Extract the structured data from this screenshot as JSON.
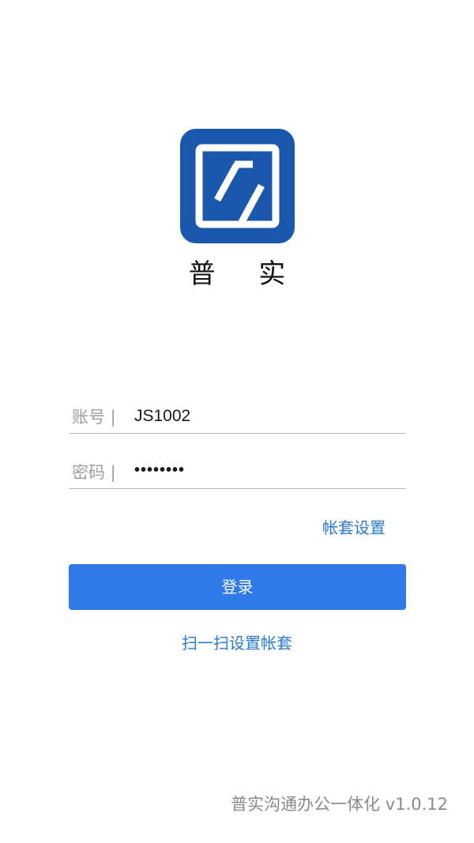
{
  "app": {
    "name": "普 实",
    "logo_icon": "pushi-logo-icon",
    "brand_color": "#1a58ad"
  },
  "login_form": {
    "account_label": "账号 |",
    "account_value": "JS1002",
    "password_label": "密码 |",
    "password_value": "••••••••",
    "account_settings_link": "帐套设置",
    "login_button": "登录",
    "scan_link": "扫一扫设置帐套"
  },
  "footer": {
    "version_text": "普实沟通办公一体化 v1.0.12"
  },
  "colors": {
    "accent": "#3079e8",
    "link": "#2979d1"
  }
}
